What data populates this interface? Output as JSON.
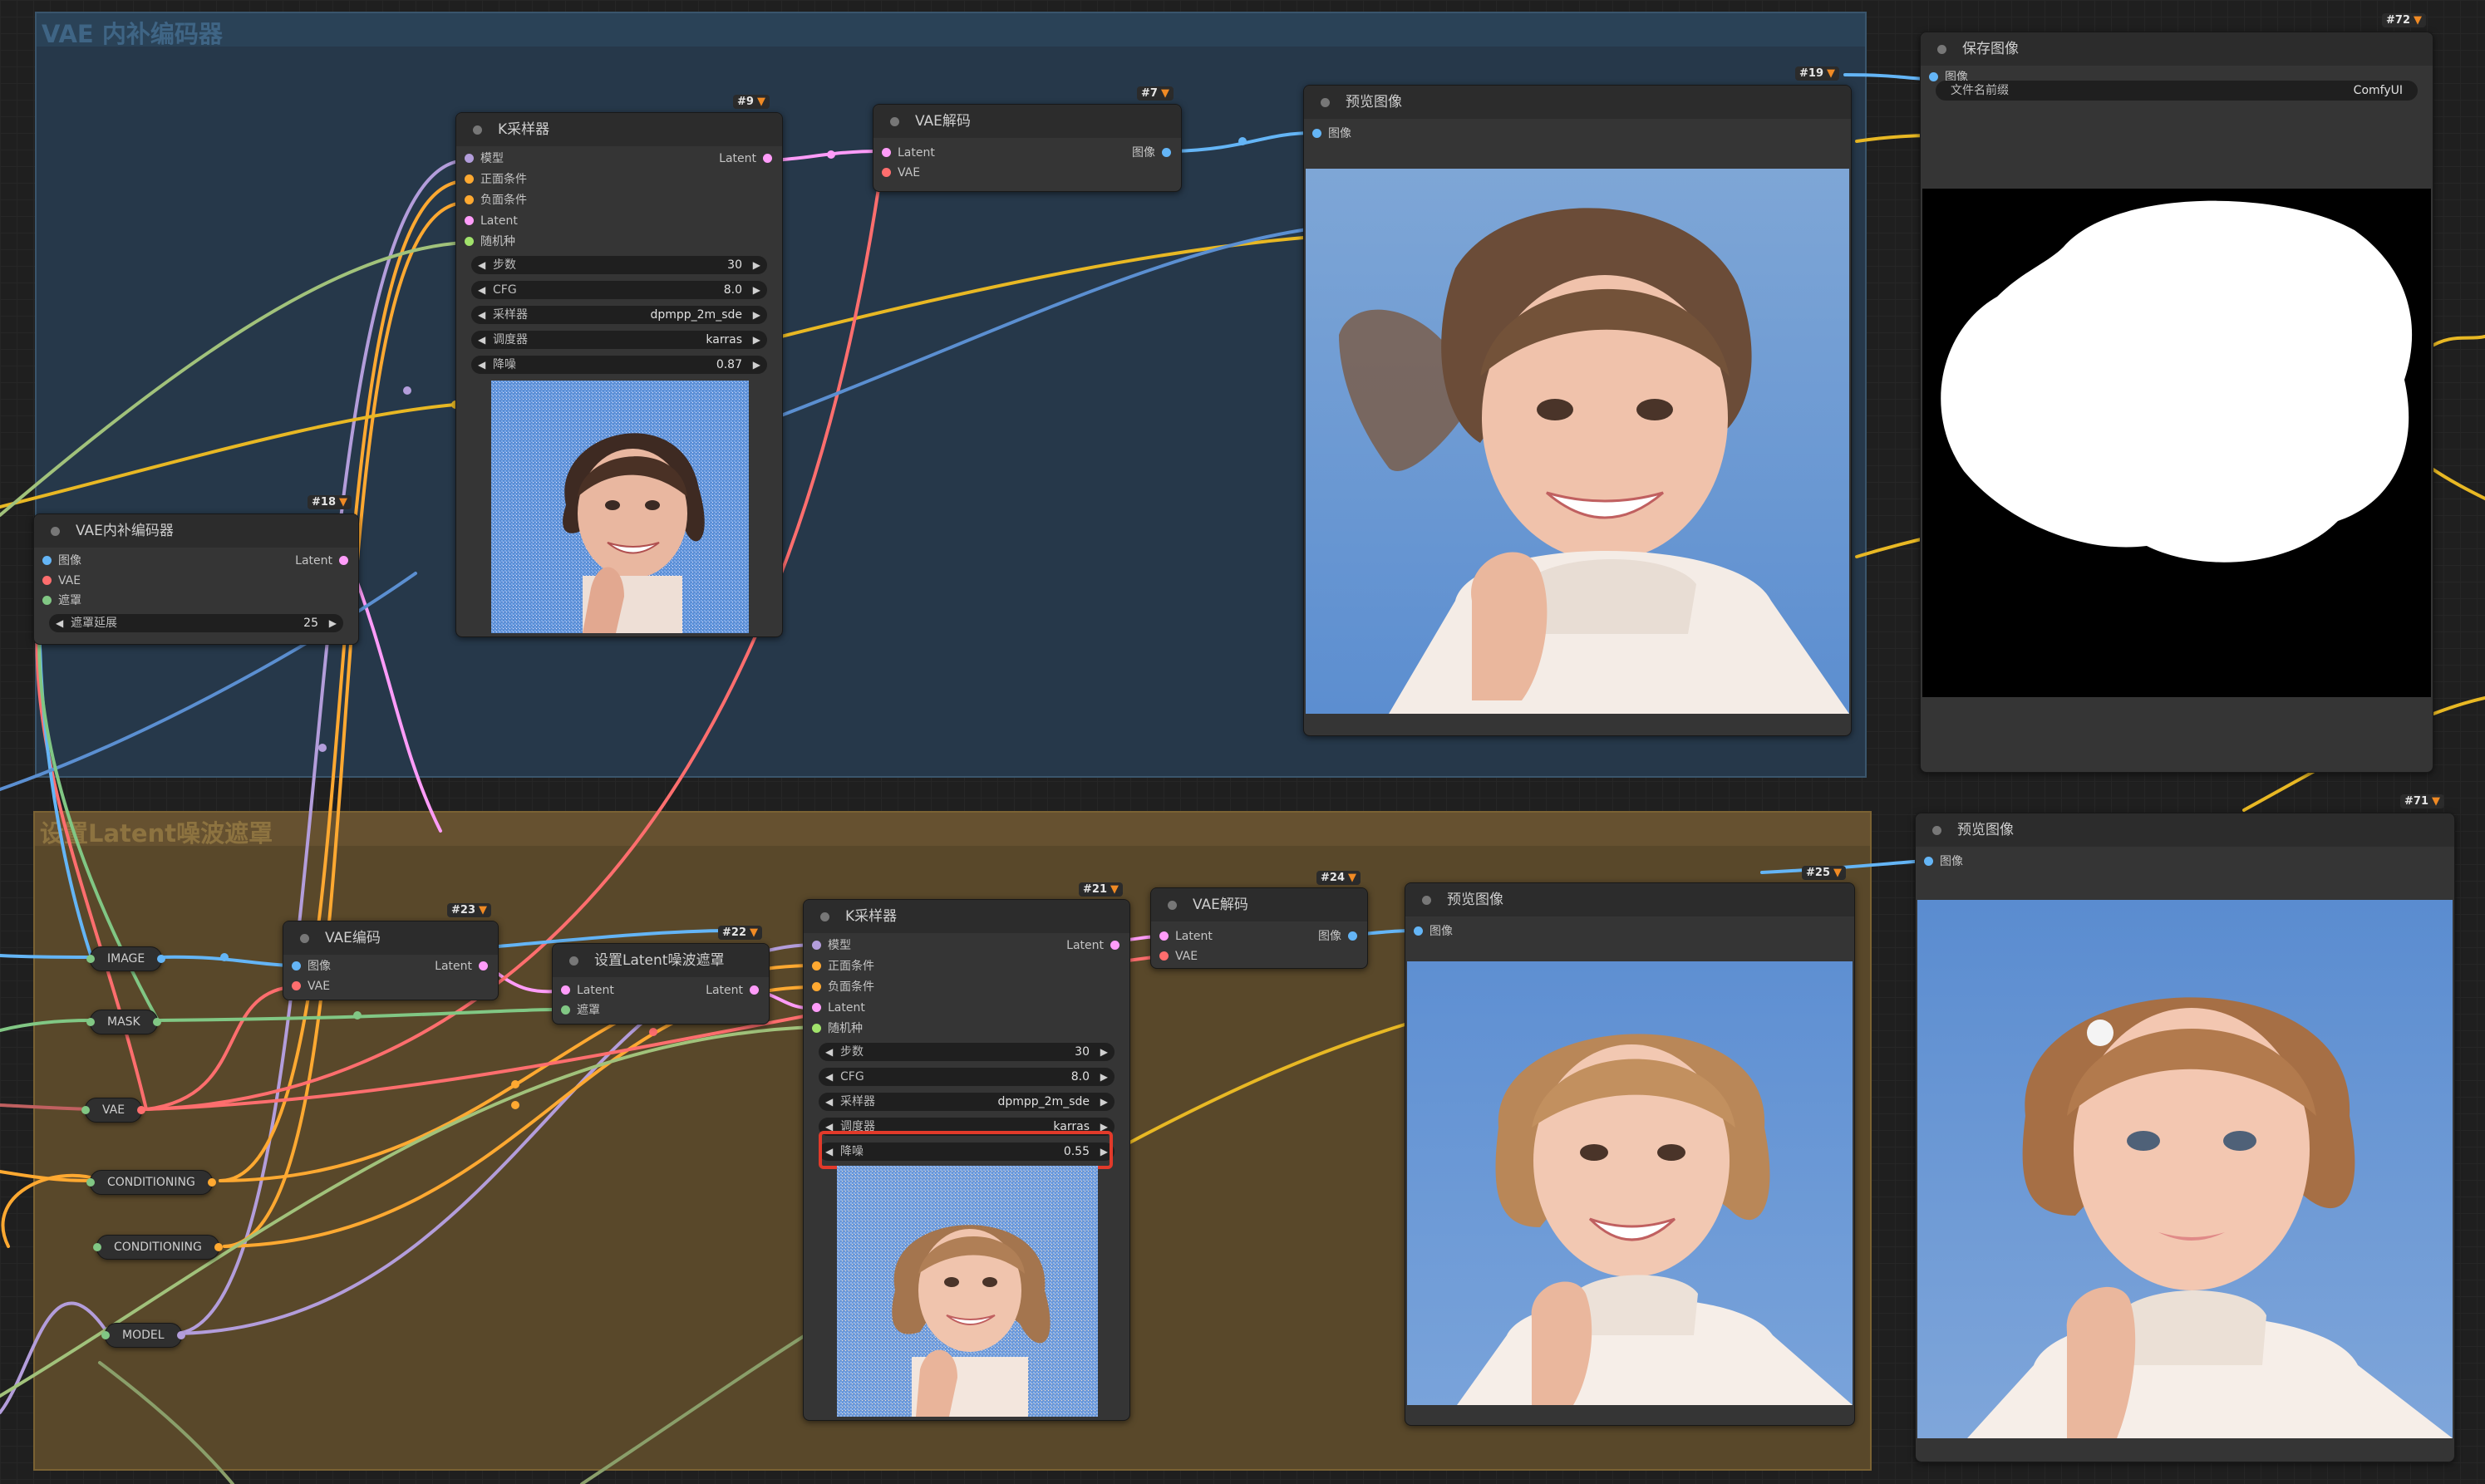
{
  "groups": {
    "vae_inpaint": "VAE 内补编码器",
    "latent_mask": "设置Latent噪波遮罩"
  },
  "colors": {
    "model": "#b39ddb",
    "conditioning": "#ffa931",
    "latent": "#ff9cf9",
    "vae": "#ff6e6e",
    "image": "#64b5f6",
    "int": "#a1e26b",
    "mask": "#81c784",
    "highlight": "#e23a2a",
    "group_vae_bg": "#26384a",
    "group_latent_bg": "#59482a"
  },
  "icons": {
    "badge": "fox-icon",
    "arrow_left": "triangle-left-icon",
    "arrow_right": "triangle-right-icon"
  },
  "nodes": {
    "ksampler1": {
      "badge": "#9",
      "title": "K采样器",
      "inputs": [
        "模型",
        "正面条件",
        "负面条件",
        "Latent",
        "随机种"
      ],
      "output": "Latent",
      "widgets": [
        {
          "label": "步数",
          "value": "30"
        },
        {
          "label": "CFG",
          "value": "8.0"
        },
        {
          "label": "采样器",
          "value": "dpmpp_2m_sde"
        },
        {
          "label": "调度器",
          "value": "karras"
        },
        {
          "label": "降噪",
          "value": "0.87"
        }
      ]
    },
    "vaedecode1": {
      "badge": "#7",
      "title": "VAE解码",
      "inputs": [
        "Latent",
        "VAE"
      ],
      "output": "图像"
    },
    "preview1": {
      "badge": "#19",
      "title": "预览图像",
      "inputs": [
        "图像"
      ]
    },
    "saveimage": {
      "badge": "#72",
      "title": "保存图像",
      "inputs": [
        "图像"
      ],
      "widget": {
        "label": "文件名前缀",
        "value": "ComfyUI"
      }
    },
    "vaeinpaint": {
      "badge": "#18",
      "title": "VAE内补编码器",
      "inputs": [
        "图像",
        "VAE",
        "遮罩"
      ],
      "output": "Latent",
      "widget": {
        "label": "遮罩延展",
        "value": "25"
      }
    },
    "vaeencode": {
      "badge": "#23",
      "title": "VAE编码",
      "inputs": [
        "图像",
        "VAE"
      ],
      "output": "Latent"
    },
    "setmask": {
      "badge": "#22",
      "title": "设置Latent噪波遮罩",
      "inputs": [
        "Latent",
        "遮罩"
      ],
      "output": "Latent"
    },
    "ksampler2": {
      "badge": "#21",
      "title": "K采样器",
      "inputs": [
        "模型",
        "正面条件",
        "负面条件",
        "Latent",
        "随机种"
      ],
      "output": "Latent",
      "widgets": [
        {
          "label": "步数",
          "value": "30"
        },
        {
          "label": "CFG",
          "value": "8.0"
        },
        {
          "label": "采样器",
          "value": "dpmpp_2m_sde"
        },
        {
          "label": "调度器",
          "value": "karras"
        },
        {
          "label": "降噪",
          "value": "0.55"
        }
      ]
    },
    "vaedecode2": {
      "badge": "#24",
      "title": "VAE解码",
      "inputs": [
        "Latent",
        "VAE"
      ],
      "output": "图像"
    },
    "preview2": {
      "badge": "#25",
      "title": "预览图像",
      "inputs": [
        "图像"
      ]
    },
    "preview3": {
      "badge": "#71",
      "title": "预览图像",
      "inputs": [
        "图像"
      ]
    }
  },
  "reroutes": [
    "IMAGE",
    "MASK",
    "VAE",
    "CONDITIONING",
    "CONDITIONING",
    "MODEL"
  ]
}
